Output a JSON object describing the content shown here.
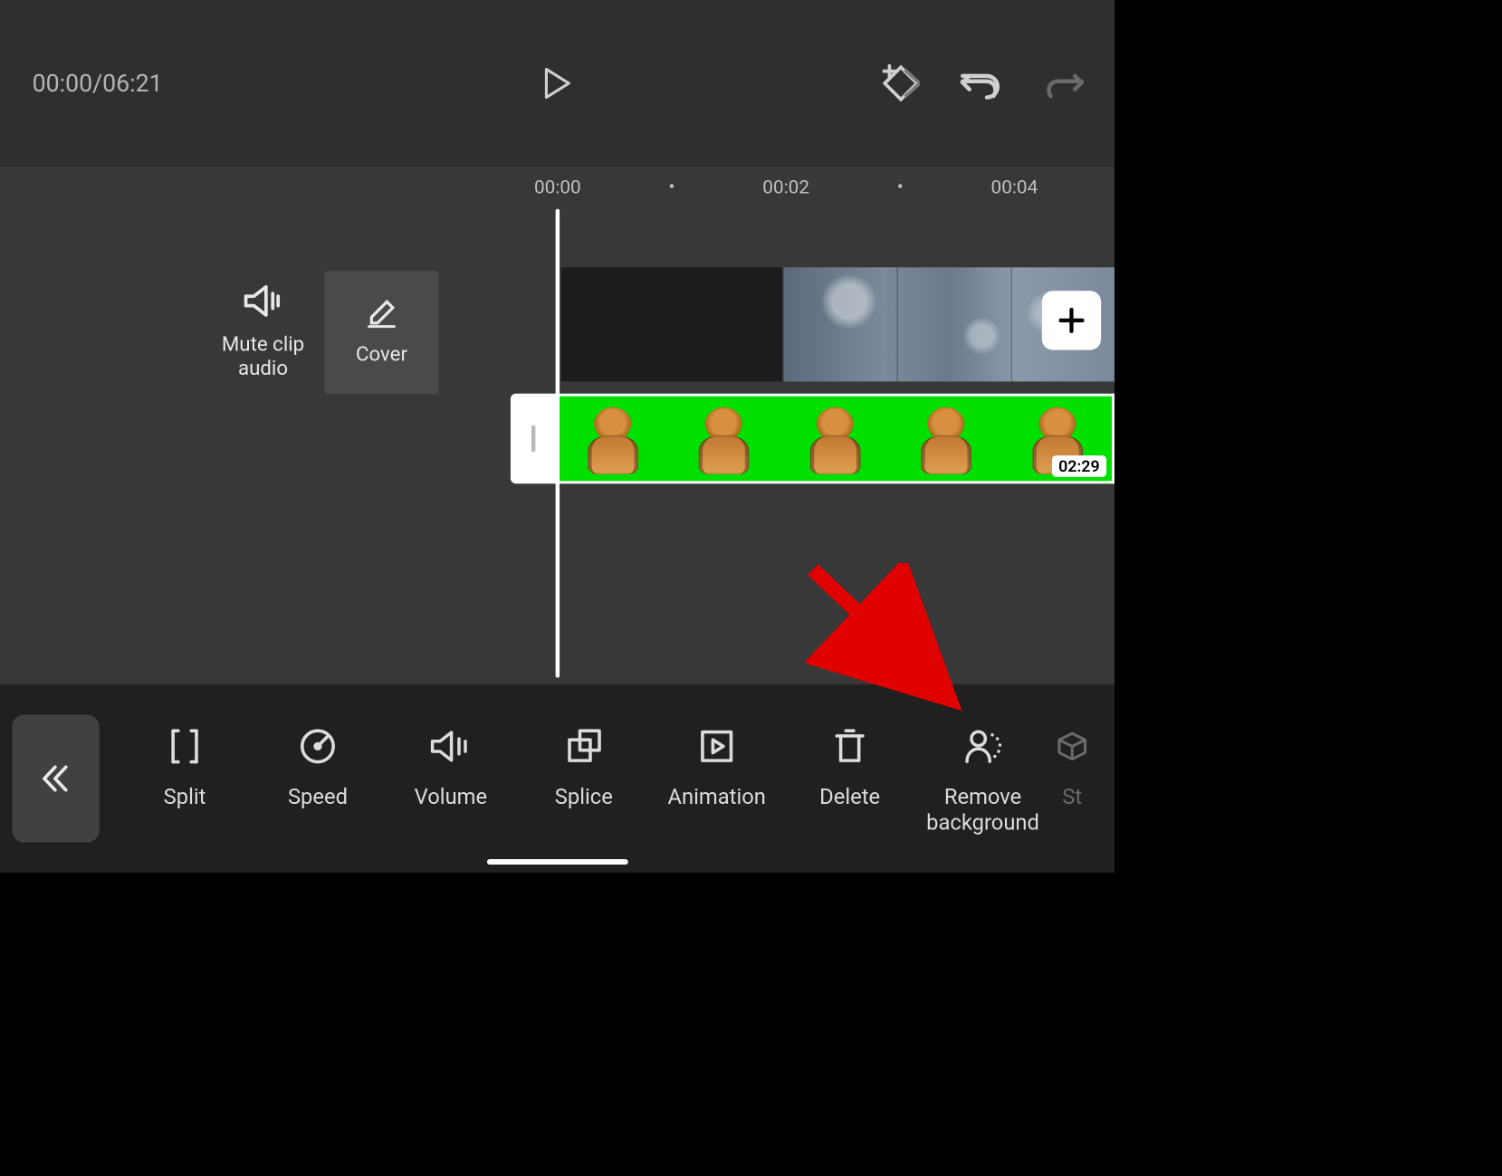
{
  "playback": {
    "position": "00:00",
    "duration": "06:21",
    "combined": "00:00/06:21"
  },
  "ruler": {
    "ticks": [
      "00:00",
      "00:02",
      "00:04"
    ]
  },
  "clip_options": {
    "mute": {
      "label_line1": "Mute clip",
      "label_line2": "audio"
    },
    "cover": {
      "label": "Cover"
    }
  },
  "overlay_clip": {
    "duration_label": "02:29"
  },
  "toolbar": {
    "items": [
      {
        "id": "split",
        "label": "Split"
      },
      {
        "id": "speed",
        "label": "Speed"
      },
      {
        "id": "volume",
        "label": "Volume"
      },
      {
        "id": "splice",
        "label": "Splice"
      },
      {
        "id": "animation",
        "label": "Animation"
      },
      {
        "id": "delete",
        "label": "Delete"
      },
      {
        "id": "remove-background",
        "label": "Remove\nbackground"
      },
      {
        "id": "style",
        "label": "St"
      }
    ]
  },
  "annotation": {
    "arrow_target": "remove-background"
  }
}
